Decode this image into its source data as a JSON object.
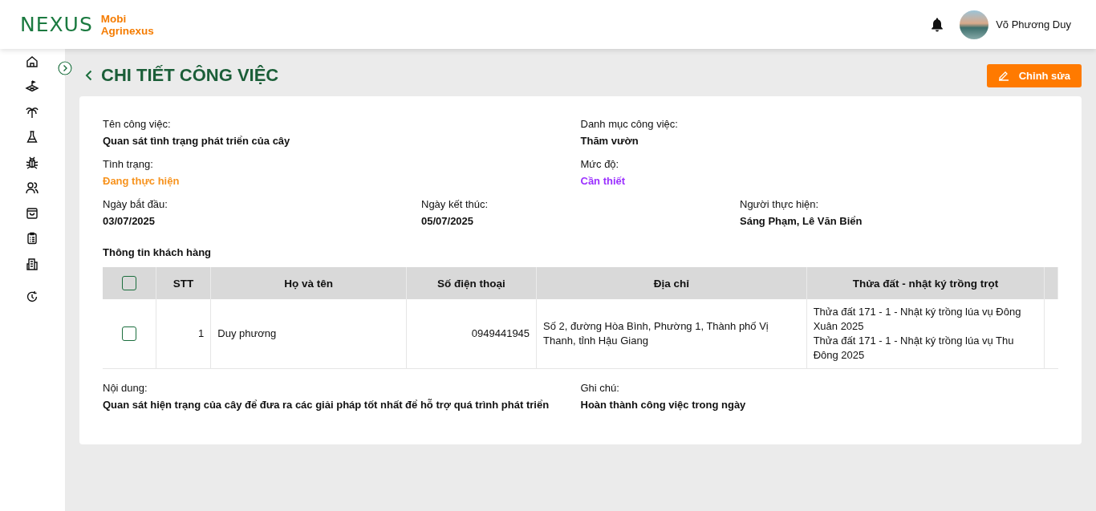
{
  "brand": {
    "logo": "NEXUS",
    "line1": "Mobi",
    "line2": "Agrinexus"
  },
  "user": {
    "name": "Võ Phương Duy"
  },
  "sidebar": {
    "items": [
      {
        "selected": false
      },
      {
        "selected": false
      },
      {
        "selected": false
      },
      {
        "selected": false
      },
      {
        "selected": false
      },
      {
        "selected": false
      },
      {
        "selected": false
      },
      {
        "selected": false
      },
      {
        "selected": false
      },
      {
        "selected": false
      }
    ]
  },
  "page": {
    "title": "CHI TIẾT CÔNG VIỆC",
    "edit_button": "Chỉnh sửa"
  },
  "fields": [
    [
      {
        "label": "Tên công việc:",
        "value": "Quan sát tình trạng phát triển của cây"
      },
      {
        "label": "Danh mục công việc:",
        "value": "Thăm vườn"
      }
    ],
    [
      {
        "label": "Tình trạng:",
        "value": "Đang thực hiện",
        "color": "#f7931e"
      },
      {
        "label": "Mức độ:",
        "value": "Cần thiết",
        "color": "#9b30ff"
      }
    ],
    [
      {
        "label": "Ngày bắt đầu:",
        "value": "03/07/2025"
      },
      {
        "label": "Ngày kết thúc:",
        "value": "05/07/2025"
      },
      {
        "label": "Người thực hiện:",
        "value": "Sáng Phạm, Lê Văn Biển"
      }
    ]
  ],
  "customers": {
    "heading": "Thông tin khách hàng",
    "all_checked": false,
    "columns": [
      "STT",
      "Họ và tên",
      "Số điện thoại",
      "Địa chỉ",
      "Thửa đất - nhật ký trồng trọt"
    ],
    "rows": [
      {
        "checked": false,
        "cells": [
          "1",
          "Duy phương",
          "0949441945",
          "Số 2, đường Hòa Bình, Phường 1, Thành phố Vị Thanh, tỉnh Hậu Giang"
        ],
        "plots": [
          "Thửa đất 171 - 1 - Nhật ký trồng lúa vụ Đông Xuân 2025",
          "Thửa đất 171 - 1 - Nhật ký trồng lúa vụ Thu Đông 2025"
        ]
      }
    ]
  },
  "notes": [
    {
      "label": "Nội dung:",
      "value": "Quan sát hiện trạng của cây để đưa ra các giải pháp tốt nhất để hỗ trợ quá trình phát triển"
    },
    {
      "label": "Ghi chú:",
      "value": "Hoàn thành công việc trong ngày"
    }
  ]
}
